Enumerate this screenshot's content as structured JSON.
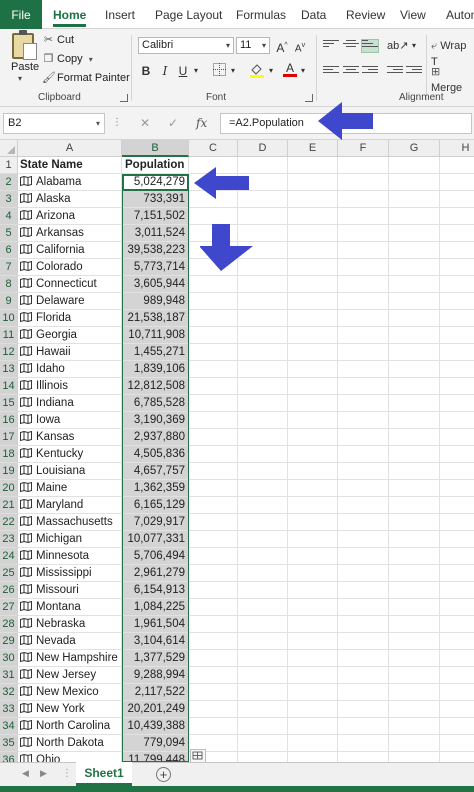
{
  "ribbon_tabs": [
    "File",
    "Home",
    "Insert",
    "Page Layout",
    "Formulas",
    "Data",
    "Review",
    "View",
    "Autom"
  ],
  "active_tab": "Home",
  "clipboard": {
    "paste_label": "Paste",
    "cut_label": "Cut",
    "copy_label": "Copy",
    "format_painter_label": "Format Painter",
    "group_label": "Clipboard"
  },
  "font": {
    "font_name": "Calibri",
    "font_size": "11",
    "group_label": "Font",
    "bold": "B",
    "italic": "I",
    "underline": "U",
    "grow": "A",
    "shrink": "A"
  },
  "alignment": {
    "wrap_label": "Wrap T",
    "merge_label": "Merge",
    "group_label": "Alignment"
  },
  "formula_bar": {
    "name_box": "B2",
    "fx_label": "fx",
    "formula": "=A2.Population"
  },
  "columns": [
    "A",
    "B",
    "C",
    "D",
    "E",
    "F",
    "G",
    "H"
  ],
  "selected_column": "B",
  "header_row": {
    "state": "State Name",
    "population": "Population"
  },
  "rows": [
    {
      "state": "Alabama",
      "population": "5,024,279"
    },
    {
      "state": "Alaska",
      "population": "733,391"
    },
    {
      "state": "Arizona",
      "population": "7,151,502"
    },
    {
      "state": "Arkansas",
      "population": "3,011,524"
    },
    {
      "state": "California",
      "population": "39,538,223"
    },
    {
      "state": "Colorado",
      "population": "5,773,714"
    },
    {
      "state": "Connecticut",
      "population": "3,605,944"
    },
    {
      "state": "Delaware",
      "population": "989,948"
    },
    {
      "state": "Florida",
      "population": "21,538,187"
    },
    {
      "state": "Georgia",
      "population": "10,711,908"
    },
    {
      "state": "Hawaii",
      "population": "1,455,271"
    },
    {
      "state": "Idaho",
      "population": "1,839,106"
    },
    {
      "state": "Illinois",
      "population": "12,812,508"
    },
    {
      "state": "Indiana",
      "population": "6,785,528"
    },
    {
      "state": "Iowa",
      "population": "3,190,369"
    },
    {
      "state": "Kansas",
      "population": "2,937,880"
    },
    {
      "state": "Kentucky",
      "population": "4,505,836"
    },
    {
      "state": "Louisiana",
      "population": "4,657,757"
    },
    {
      "state": "Maine",
      "population": "1,362,359"
    },
    {
      "state": "Maryland",
      "population": "6,165,129"
    },
    {
      "state": "Massachusetts",
      "population": "7,029,917"
    },
    {
      "state": "Michigan",
      "population": "10,077,331"
    },
    {
      "state": "Minnesota",
      "population": "5,706,494"
    },
    {
      "state": "Mississippi",
      "population": "2,961,279"
    },
    {
      "state": "Missouri",
      "population": "6,154,913"
    },
    {
      "state": "Montana",
      "population": "1,084,225"
    },
    {
      "state": "Nebraska",
      "population": "1,961,504"
    },
    {
      "state": "Nevada",
      "population": "3,104,614"
    },
    {
      "state": "New Hampshire",
      "population": "1,377,529"
    },
    {
      "state": "New Jersey",
      "population": "9,288,994"
    },
    {
      "state": "New Mexico",
      "population": "2,117,522"
    },
    {
      "state": "New York",
      "population": "20,201,249"
    },
    {
      "state": "North Carolina",
      "population": "10,439,388"
    },
    {
      "state": "North Dakota",
      "population": "779,094"
    },
    {
      "state": "Ohio",
      "population": "11,799,448"
    }
  ],
  "sheet_tabs": [
    "Sheet1"
  ],
  "add_sheet_label": "+",
  "colors": {
    "accent": "#217346",
    "file_tab": "#1e7145",
    "arrow": "#3f48cc"
  }
}
